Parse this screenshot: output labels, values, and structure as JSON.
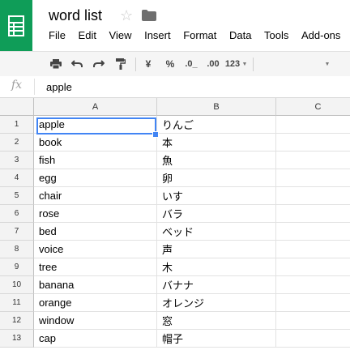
{
  "doc": {
    "title": "word list"
  },
  "menu": [
    "File",
    "Edit",
    "View",
    "Insert",
    "Format",
    "Data",
    "Tools",
    "Add-ons"
  ],
  "toolbar": {
    "currency": "¥",
    "percent": "%",
    "dec_less": ".0_",
    "dec_more": ".00",
    "format": "123"
  },
  "formula": {
    "value": "apple"
  },
  "columns": [
    "A",
    "B",
    "C"
  ],
  "rows": [
    {
      "num": "1",
      "a": "apple",
      "b": "りんご"
    },
    {
      "num": "2",
      "a": "book",
      "b": "本"
    },
    {
      "num": "3",
      "a": "fish",
      "b": "魚"
    },
    {
      "num": "4",
      "a": "egg",
      "b": "卵"
    },
    {
      "num": "5",
      "a": "chair",
      "b": "いす"
    },
    {
      "num": "6",
      "a": "rose",
      "b": "バラ"
    },
    {
      "num": "7",
      "a": "bed",
      "b": "ベッド"
    },
    {
      "num": "8",
      "a": "voice",
      "b": "声"
    },
    {
      "num": "9",
      "a": "tree",
      "b": "木"
    },
    {
      "num": "10",
      "a": "banana",
      "b": "バナナ"
    },
    {
      "num": "11",
      "a": "orange",
      "b": "オレンジ"
    },
    {
      "num": "12",
      "a": "window",
      "b": "窓"
    },
    {
      "num": "13",
      "a": "cap",
      "b": "帽子"
    }
  ],
  "colors": {
    "brand": "#0f9d58",
    "selection": "#4285f4"
  }
}
